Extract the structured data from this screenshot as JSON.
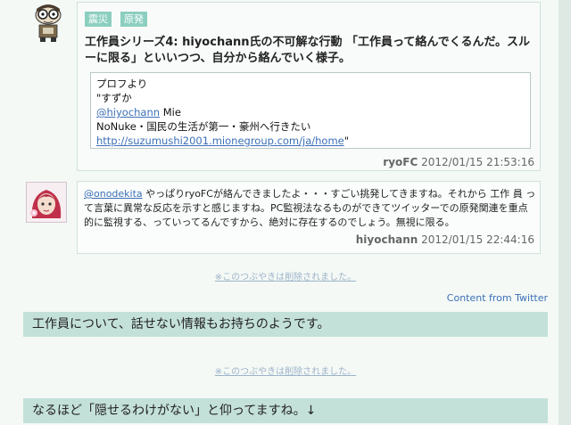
{
  "tweet1": {
    "tags": [
      "震災",
      "原発"
    ],
    "text": "工作員シリーズ4: hiyochann氏の不可解な行動 「工作員って絡んでくるんだ。スルーに限る」といいつつ、自分から絡んでいく様子。",
    "quote": {
      "line1": "プロフより",
      "line2": "\"すずか",
      "mention": "@hiyochann",
      "mention_suffix": " Mie",
      "line4": "NoNuke・国民の生活が第一・豪州へ行きたい",
      "url": "http://suzumushi2001.mionegroup.com/ja/home",
      "url_suffix": "\""
    },
    "user": "ryoFC",
    "timestamp": "2012/01/15 21:53:16"
  },
  "tweet2": {
    "mention": "@onodekita",
    "text": " やっぱりryoFCが絡んできましたよ・・・すごい挑発してきますね。それから 工作 員 って言葉に異常な反応を示すと感じますね。PC監視法なるものができてツイッターでの原発関連を重点的に監視する、っていってるんですから、絶対に存在するのでしょう。無視に限る。",
    "user": "hiyochann",
    "timestamp": "2012/01/15 22:44:16"
  },
  "deleted_text_1": "※このつぶやきは削除されました。",
  "content_from": "Content from Twitter",
  "comment1": "工作員について、話せない情報もお持ちのようです。",
  "deleted_text_2": "※このつぶやきは削除されました。",
  "comment2": "なるほど「隠せるわけがない」と仰ってますね。↓",
  "colors": {
    "background": "#f4f9f6",
    "tag": "#8ccfc0",
    "comment_bar": "#c4e1d9",
    "link": "#3b6fb6"
  }
}
